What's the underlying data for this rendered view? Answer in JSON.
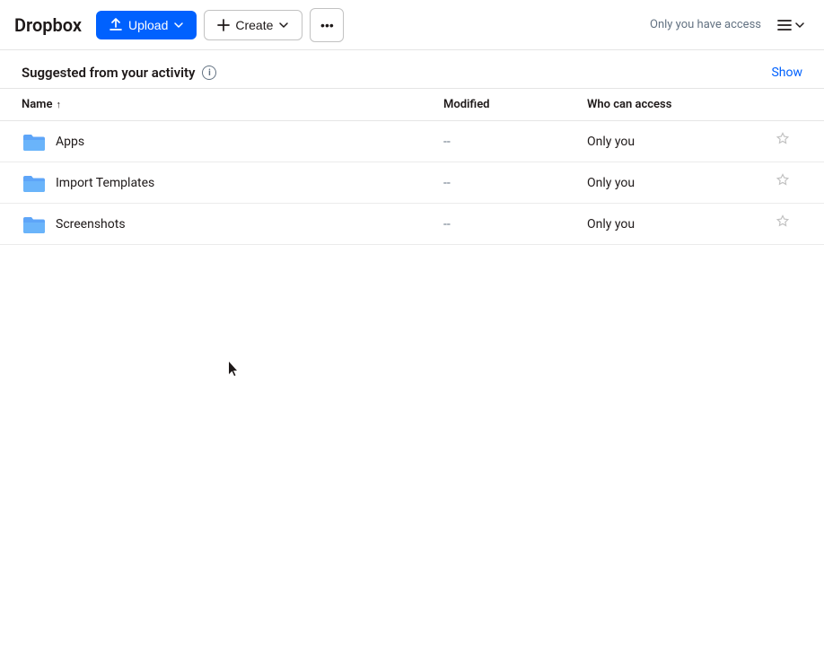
{
  "header": {
    "title": "Dropbox",
    "upload_label": "Upload",
    "create_label": "Create",
    "more_dots": "···",
    "access_label": "Only you have access"
  },
  "suggested": {
    "title": "Suggested from your activity",
    "info_icon": "i",
    "show_label": "Show"
  },
  "table": {
    "col_name": "Name",
    "col_modified": "Modified",
    "col_access": "Who can access",
    "sort_arrow": "↑",
    "rows": [
      {
        "name": "Apps",
        "modified": "--",
        "access": "Only you"
      },
      {
        "name": "Import Templates",
        "modified": "--",
        "access": "Only you"
      },
      {
        "name": "Screenshots",
        "modified": "--",
        "access": "Only you"
      }
    ]
  }
}
